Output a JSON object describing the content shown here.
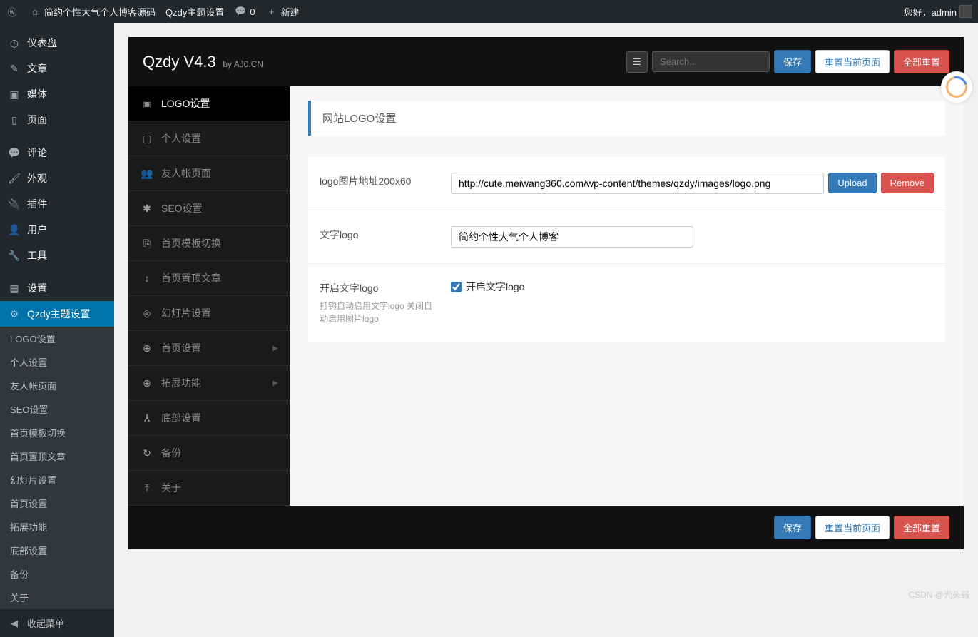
{
  "adminbar": {
    "site_title": "简约个性大气个人博客源码",
    "theme_settings": "Qzdy主题设置",
    "comments_count": "0",
    "new": "新建",
    "greeting": "您好，admin"
  },
  "wp_menu": [
    {
      "icon": "◷",
      "label": "仪表盘"
    },
    {
      "icon": "✎",
      "label": "文章"
    },
    {
      "icon": "▣",
      "label": "媒体"
    },
    {
      "icon": "▯",
      "label": "页面"
    },
    {
      "icon": "💬",
      "label": "评论"
    },
    {
      "icon": "🖌",
      "label": "外观"
    },
    {
      "icon": "🔌",
      "label": "插件"
    },
    {
      "icon": "👤",
      "label": "用户"
    },
    {
      "icon": "🔧",
      "label": "工具"
    },
    {
      "icon": "▦",
      "label": "设置"
    },
    {
      "icon": "⚙",
      "label": "Qzdy主题设置"
    }
  ],
  "wp_submenu": [
    "LOGO设置",
    "个人设置",
    "友人帐页面",
    "SEO设置",
    "首页模板切换",
    "首页置顶文章",
    "幻灯片设置",
    "首页设置",
    "拓展功能",
    "底部设置",
    "备份",
    "关于"
  ],
  "collapse": "收起菜单",
  "theme": {
    "title": "Qzdy V4.3",
    "by": "by AJ0.CN",
    "search_placeholder": "Search...",
    "save": "保存",
    "reset_page": "重置当前页面",
    "reset_all": "全部重置"
  },
  "theme_nav": [
    {
      "icon": "▣",
      "label": "LOGO设置",
      "active": true
    },
    {
      "icon": "▢",
      "label": "个人设置"
    },
    {
      "icon": "👥",
      "label": "友人帐页面"
    },
    {
      "icon": "✱",
      "label": "SEO设置"
    },
    {
      "icon": "⎘",
      "label": "首页模板切换"
    },
    {
      "icon": "↕",
      "label": "首页置顶文章"
    },
    {
      "icon": "⎆",
      "label": "幻灯片设置"
    },
    {
      "icon": "⊕",
      "label": "首页设置",
      "caret": true
    },
    {
      "icon": "⊕",
      "label": "拓展功能",
      "caret": true
    },
    {
      "icon": "⅄",
      "label": "底部设置"
    },
    {
      "icon": "↻",
      "label": "备份"
    },
    {
      "icon": "⤒",
      "label": "关于"
    }
  ],
  "section_title": "网站LOGO设置",
  "form": {
    "logo_url_label": "logo图片地址200x60",
    "logo_url": "http://cute.meiwang360.com/wp-content/themes/qzdy/images/logo.png",
    "upload": "Upload",
    "remove": "Remove",
    "text_logo_label": "文字logo",
    "text_logo": "简约个性大气个人博客",
    "enable_text_logo_label": "开启文字logo",
    "enable_text_logo_help": "打钩自动启用文字logo 关闭自动启用图片logo",
    "enable_text_logo_checkbox": "开启文字logo"
  },
  "watermark": "CSDN @光头弱"
}
